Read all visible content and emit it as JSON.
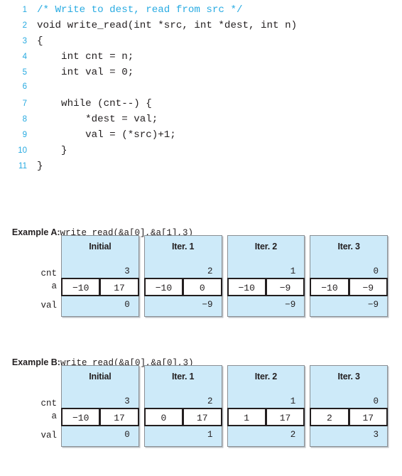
{
  "code": {
    "lines": [
      {
        "n": "1",
        "text": "/* Write to dest, read from src */",
        "comment": true
      },
      {
        "n": "2",
        "text": "void write_read(int *src, int *dest, int n)",
        "comment": false
      },
      {
        "n": "3",
        "text": "{",
        "comment": false
      },
      {
        "n": "4",
        "text": "    int cnt = n;",
        "comment": false
      },
      {
        "n": "5",
        "text": "    int val = 0;",
        "comment": false
      },
      {
        "n": "6",
        "text": "",
        "comment": false
      },
      {
        "n": "7",
        "text": "    while (cnt--) {",
        "comment": false
      },
      {
        "n": "8",
        "text": "        *dest = val;",
        "comment": false
      },
      {
        "n": "9",
        "text": "        val = (*src)+1;",
        "comment": false
      },
      {
        "n": "10",
        "text": "    }",
        "comment": false
      },
      {
        "n": "11",
        "text": "}",
        "comment": false
      }
    ]
  },
  "colors": {
    "panel_fill": "#cdeaf9",
    "line_number": "#27aae1",
    "comment": "#29abe2",
    "text": "#231f20",
    "cell_border": "#231f20",
    "panel_border": "#8a8f94"
  },
  "examples": [
    {
      "label": "Example A:",
      "call": "write_read(&a[0],&a[1],3)",
      "row_labels": {
        "cnt": "cnt",
        "a": "a",
        "val": "val"
      },
      "columns": [
        {
          "header": "Initial",
          "cnt": "3",
          "a": [
            "−10",
            "17"
          ],
          "val": "0"
        },
        {
          "header": "Iter. 1",
          "cnt": "2",
          "a": [
            "−10",
            "0"
          ],
          "val": "−9"
        },
        {
          "header": "Iter. 2",
          "cnt": "1",
          "a": [
            "−10",
            "−9"
          ],
          "val": "−9"
        },
        {
          "header": "Iter. 3",
          "cnt": "0",
          "a": [
            "−10",
            "−9"
          ],
          "val": "−9"
        }
      ]
    },
    {
      "label": "Example B:",
      "call": "write_read(&a[0],&a[0],3)",
      "row_labels": {
        "cnt": "cnt",
        "a": "a",
        "val": "val"
      },
      "columns": [
        {
          "header": "Initial",
          "cnt": "3",
          "a": [
            "−10",
            "17"
          ],
          "val": "0"
        },
        {
          "header": "Iter. 1",
          "cnt": "2",
          "a": [
            "0",
            "17"
          ],
          "val": "1"
        },
        {
          "header": "Iter. 2",
          "cnt": "1",
          "a": [
            "1",
            "17"
          ],
          "val": "2"
        },
        {
          "header": "Iter. 3",
          "cnt": "0",
          "a": [
            "2",
            "17"
          ],
          "val": "3"
        }
      ]
    }
  ]
}
